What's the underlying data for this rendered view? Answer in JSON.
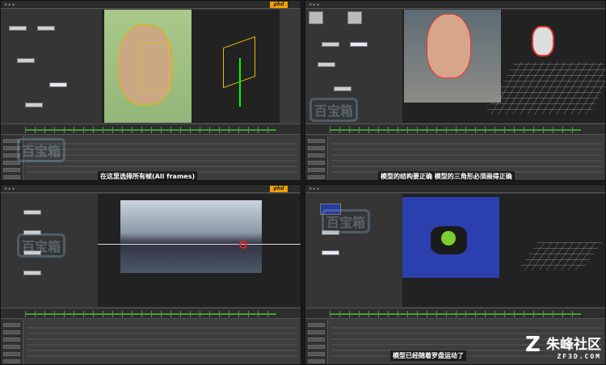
{
  "panels": [
    {
      "id": "q1",
      "logo": "phd",
      "subtitle": "在这里选择所有帧(All frames)"
    },
    {
      "id": "q2",
      "logo": "phd",
      "subtitle": "模型的结构要正确 模型的三角形必须画得正确"
    },
    {
      "id": "q3",
      "logo": "phd",
      "subtitle": ""
    },
    {
      "id": "q4",
      "logo": "phd",
      "subtitle": "模型已经随着罗盘运动了"
    }
  ],
  "watermark": {
    "text": "百宝箱"
  },
  "brand": {
    "name": "朱峰社区",
    "url": "ZF3D.COM",
    "mark": "Z"
  }
}
